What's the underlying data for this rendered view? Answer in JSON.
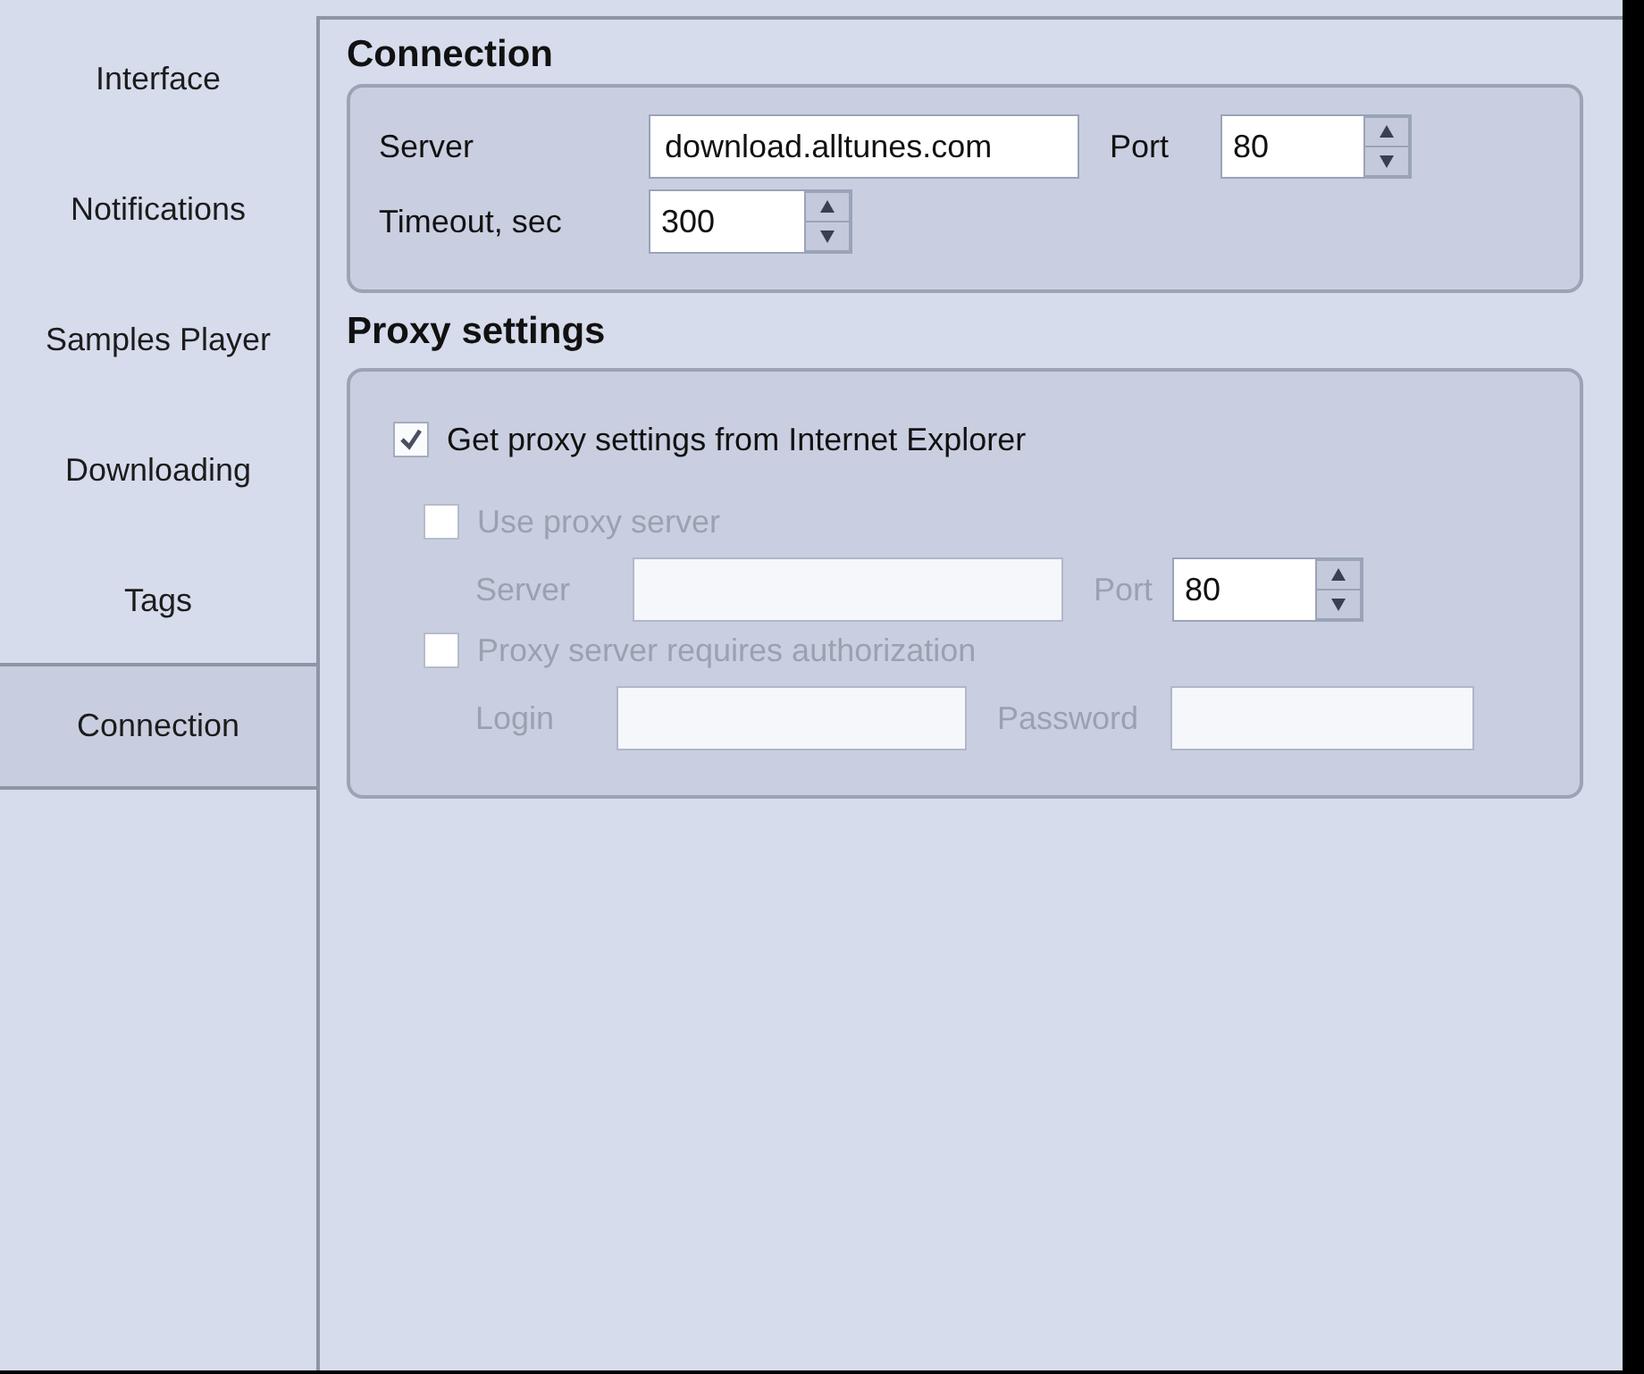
{
  "sidebar": {
    "items": [
      {
        "label": "Interface",
        "selected": false
      },
      {
        "label": "Notifications",
        "selected": false
      },
      {
        "label": "Samples Player",
        "selected": false
      },
      {
        "label": "Downloading",
        "selected": false
      },
      {
        "label": "Tags",
        "selected": false
      },
      {
        "label": "Connection",
        "selected": true
      }
    ]
  },
  "connection": {
    "title": "Connection",
    "server": {
      "label": "Server",
      "value": "download.alltunes.com"
    },
    "port": {
      "label": "Port",
      "value": "80"
    },
    "timeout": {
      "label": "Timeout, sec",
      "value": "300"
    }
  },
  "proxy": {
    "title": "Proxy settings",
    "from_ie": {
      "label": "Get proxy settings from Internet Explorer",
      "checked": true,
      "disabled": false
    },
    "use_proxy": {
      "label": "Use proxy server",
      "checked": false,
      "disabled": true
    },
    "server": {
      "label": "Server",
      "disabled": true
    },
    "port": {
      "label": "Port",
      "value": "80",
      "disabled": true
    },
    "auth": {
      "label": "Proxy server requires authorization",
      "checked": false,
      "disabled": true
    },
    "login": {
      "label": "Login",
      "disabled": true
    },
    "password": {
      "label": "Password",
      "disabled": true
    }
  }
}
